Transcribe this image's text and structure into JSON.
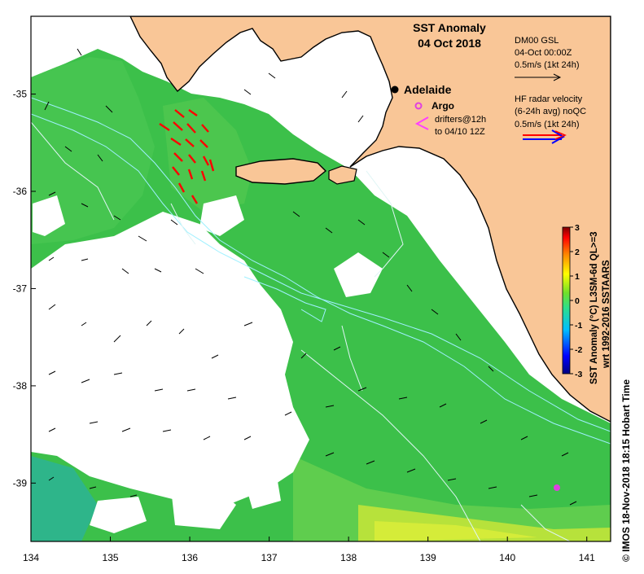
{
  "title": {
    "line1": "SST Anomaly",
    "line2": "04 Oct 2018"
  },
  "axes": {
    "x_ticks": [
      "134",
      "135",
      "136",
      "137",
      "138",
      "139",
      "140",
      "141"
    ],
    "y_ticks": [
      "-35",
      "-36",
      "-37",
      "-38",
      "-39"
    ]
  },
  "map_extent": {
    "lon": [
      134.0,
      141.3
    ],
    "lat": [
      -39.6,
      -34.2
    ]
  },
  "places": [
    {
      "name": "Adelaide",
      "lon": 138.6,
      "lat": -34.93
    }
  ],
  "argo": {
    "label": "Argo",
    "lon": 140.62,
    "lat": -38.95,
    "color": "#e040e0"
  },
  "legend": {
    "dm_line1": "DM00 GSL",
    "dm_line2": "04-Oct 00:00Z",
    "dm_line3": "0.5m/s (1kt 24h)",
    "argo_label": "Argo",
    "drifters_line1": "drifters@12h",
    "drifters_line2": "to 04/10 12Z",
    "hf_line1": "HF radar velocity",
    "hf_line2": "(6-24h avg) noQC",
    "hf_line3": "0.5m/s (1kt 24h)"
  },
  "colorbar": {
    "ticks": [
      "3",
      "2",
      "1",
      "0",
      "-1",
      "-2",
      "-3"
    ],
    "range": [
      -3,
      3
    ],
    "label_line1": "SST Anomaly (°C) L3SM-6d QL>=3",
    "label_line2": "wrt 1992-2016 SSTAARS"
  },
  "copyright": "© IMOS 18-Nov-2018 18:15 Hobart Time",
  "colors": {
    "land": "#f9c697",
    "sea_main": "#3cc04a",
    "sea_light": "#5fcd4e",
    "sea_bluegreen": "#2eb58a",
    "sea_warm": "#b7e23b",
    "coast": "#000000",
    "contour": "#9ff0ff",
    "hf_red": "#ff0000",
    "hf_blue": "#0000ff",
    "drifter": "#ff40ff"
  },
  "icons": {
    "city": "filled-circle",
    "argo": "star-marker",
    "drifter": "chevron-left"
  }
}
